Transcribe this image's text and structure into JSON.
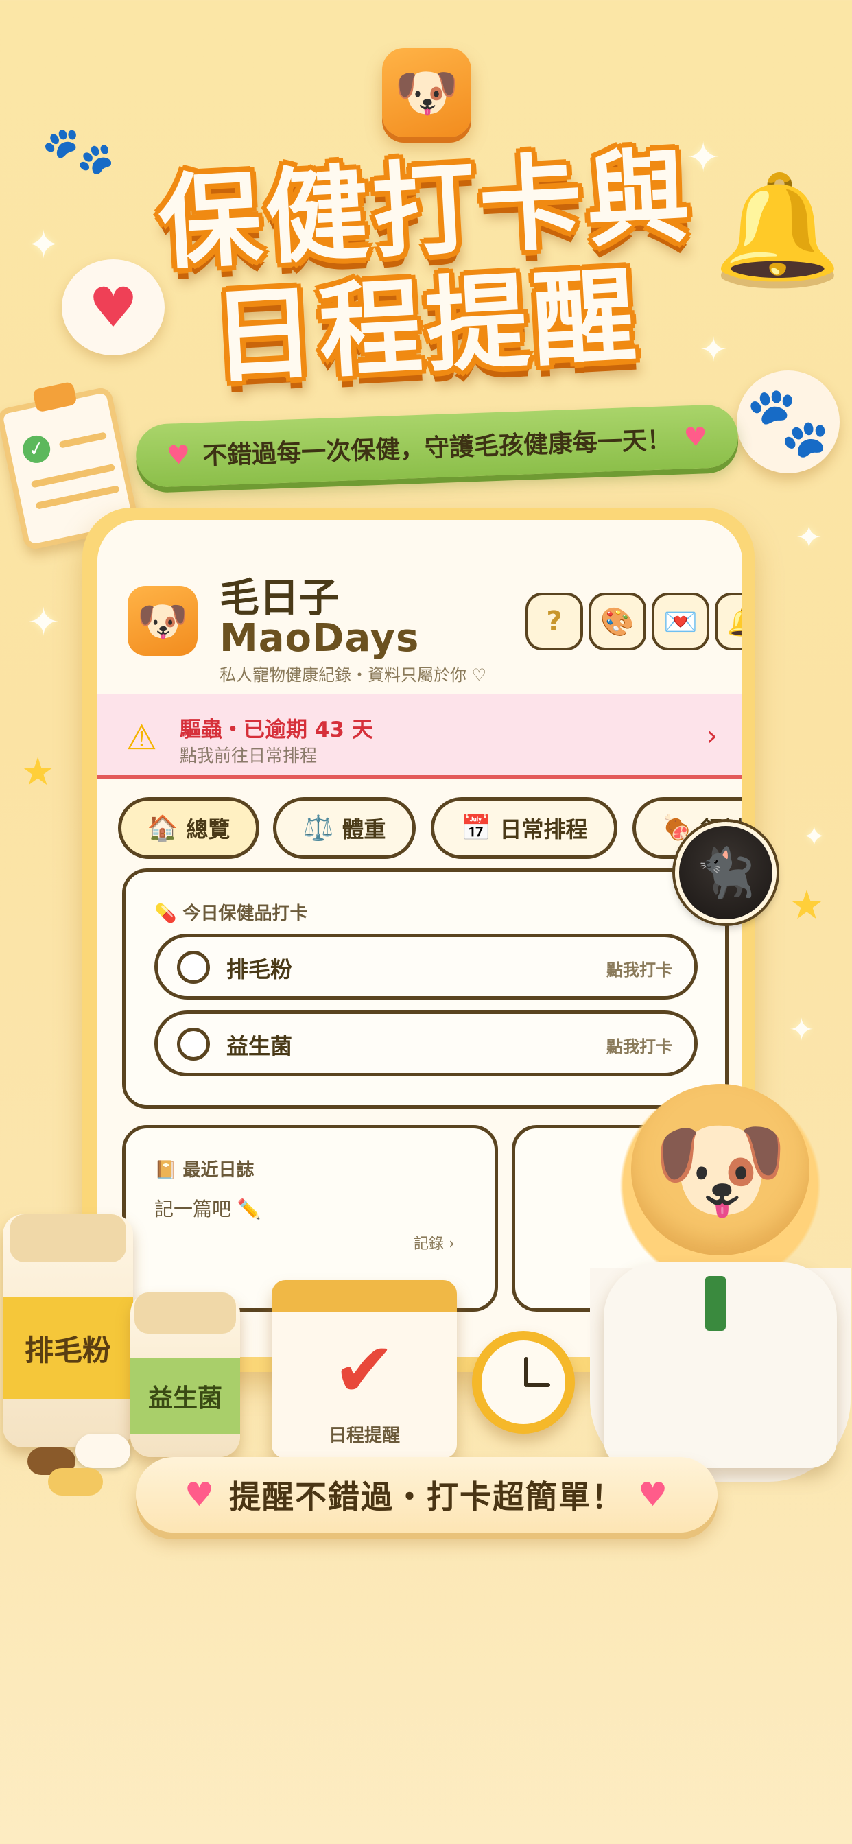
{
  "poster": {
    "headline_line1": "保健打卡與",
    "headline_line2": "日程提醒",
    "tagline": "不錯過每一次保健，守護毛孩健康每一天！",
    "bottom_banner": "提醒不錯過・打卡超簡單！",
    "logo_icon": "dog-and-cat-icon"
  },
  "app": {
    "name_cn": "毛日子",
    "name_en": "MaoDays",
    "subtitle": "私人寵物健康紀錄・資料只屬於你 ♡",
    "header_buttons": [
      {
        "id": "help",
        "glyph": "?"
      },
      {
        "id": "theme",
        "glyph": "🎨"
      },
      {
        "id": "mail",
        "glyph": "💌"
      },
      {
        "id": "notifications",
        "glyph": "🔔"
      }
    ]
  },
  "alert": {
    "title": "驅蟲・已逾期 43 天",
    "subtitle": "點我前往日常排程",
    "chevron": "›",
    "icon": "warning-icon",
    "color": "#d6303a"
  },
  "tabs": [
    {
      "label": "總覽",
      "icon": "🏠"
    },
    {
      "label": "體重",
      "icon": "⚖️"
    },
    {
      "label": "日常排程",
      "icon": "📅"
    },
    {
      "label": "飼料保健",
      "icon": "🍖"
    }
  ],
  "checkin": {
    "title": "今日保健品打卡",
    "title_icon": "💊",
    "items": [
      {
        "label": "排毛粉",
        "action": "點我打卡"
      },
      {
        "label": "益生菌",
        "action": "點我打卡"
      }
    ]
  },
  "journal": {
    "title": "最近日誌",
    "title_icon": "📔",
    "placeholder": "記一篇吧",
    "link": "記錄 ›"
  },
  "props": {
    "jar1_label": "排毛粉",
    "jar2_label": "益生菌",
    "calendar_label": "日程提醒"
  }
}
